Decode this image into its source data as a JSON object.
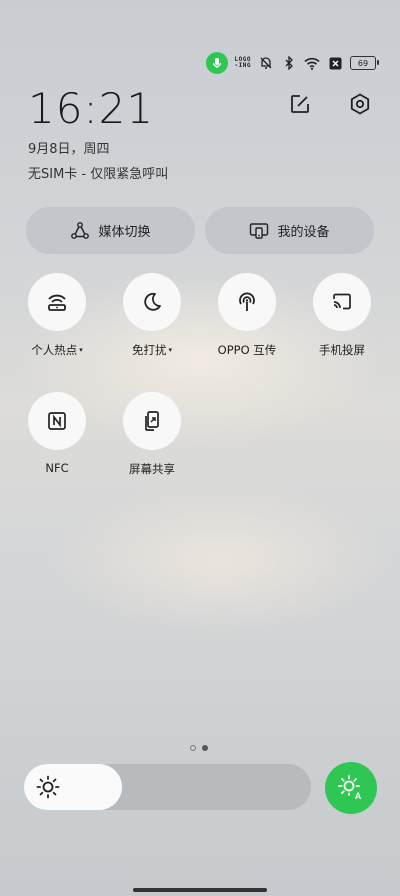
{
  "status": {
    "logo_text_top": "LOGO",
    "logo_text_bottom": "-ING",
    "battery": "69",
    "icons": [
      "mic-icon",
      "logo-icon",
      "mute-icon",
      "bluetooth-icon",
      "wifi-icon",
      "no-sim-icon",
      "battery-icon"
    ]
  },
  "header": {
    "time": "16:21",
    "date": "9月8日，周四",
    "sim_status": "无SIM卡 - 仅限紧急呼叫"
  },
  "pills": [
    {
      "label": "媒体切换",
      "icon": "media-switch-icon"
    },
    {
      "label": "我的设备",
      "icon": "my-devices-icon"
    }
  ],
  "tiles": [
    {
      "label": "个人热点",
      "icon": "hotspot-icon",
      "has_menu": true
    },
    {
      "label": "免打扰",
      "icon": "moon-icon",
      "has_menu": true
    },
    {
      "label": "OPPO 互传",
      "icon": "share-icon",
      "has_menu": false
    },
    {
      "label": "手机投屏",
      "icon": "cast-icon",
      "has_menu": false
    },
    {
      "label": "NFC",
      "icon": "nfc-icon",
      "has_menu": false
    },
    {
      "label": "屏幕共享",
      "icon": "screen-share-icon",
      "has_menu": false
    }
  ],
  "caret": "▾",
  "pager": {
    "count": 2,
    "active": 2
  },
  "brightness": {
    "level": 0.34
  },
  "colors": {
    "accent": "#2fc653",
    "tile_bg": "#f8f8f8"
  }
}
